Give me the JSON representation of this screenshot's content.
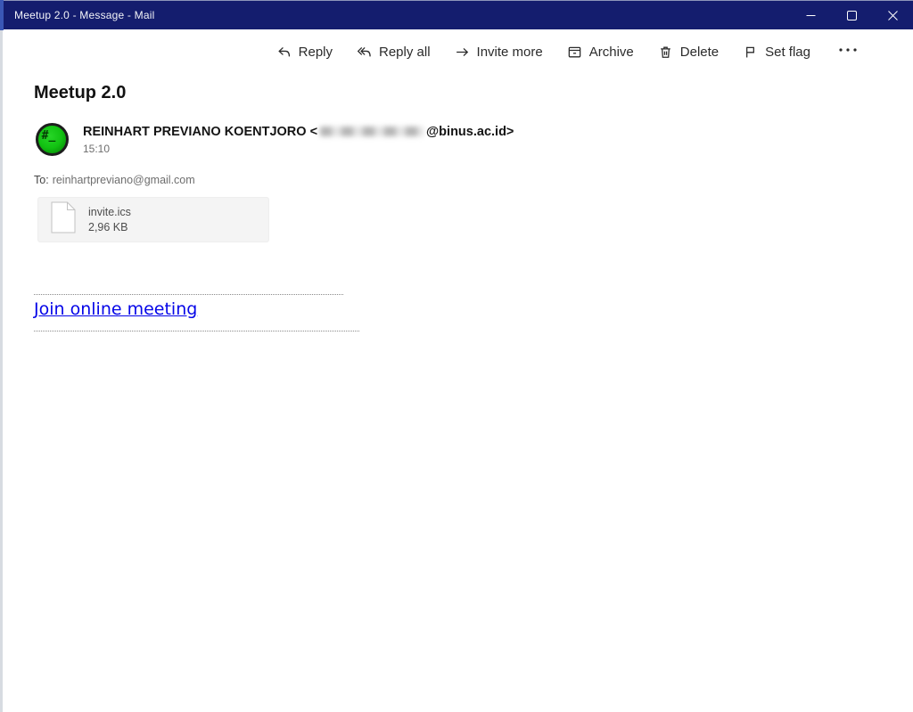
{
  "titlebar": {
    "title": "Meetup 2.0 - Message - Mail"
  },
  "window_controls": {
    "minimize": "minimize",
    "maximize": "maximize",
    "close": "close"
  },
  "toolbar": {
    "items": [
      {
        "label": "Reply",
        "icon": "reply-icon"
      },
      {
        "label": "Reply all",
        "icon": "reply-all-icon"
      },
      {
        "label": "Invite more",
        "icon": "arrow-right-icon"
      },
      {
        "label": "Archive",
        "icon": "archive-icon"
      },
      {
        "label": "Delete",
        "icon": "trash-icon"
      },
      {
        "label": "Set flag",
        "icon": "flag-icon"
      }
    ],
    "more_label": "more-options"
  },
  "message": {
    "subject": "Meetup 2.0",
    "avatar_glyph": "#_",
    "sender_name_with_bracket": "REINHART PREVIANO KOENTJORO <",
    "sender_domain_with_bracket": "@binus.ac.id>",
    "time": "15:10",
    "to_label": "To:",
    "to_address": "reinhartpreviano@gmail.com",
    "attachment": {
      "filename": "invite.ics",
      "size": "2,96 KB"
    },
    "link_text": "Join online meeting"
  },
  "colors": {
    "titlebar_bg": "#141d6e",
    "link_blue": "#0505e8",
    "avatar_green": "#12c212",
    "attachment_bg": "#f4f4f4"
  }
}
